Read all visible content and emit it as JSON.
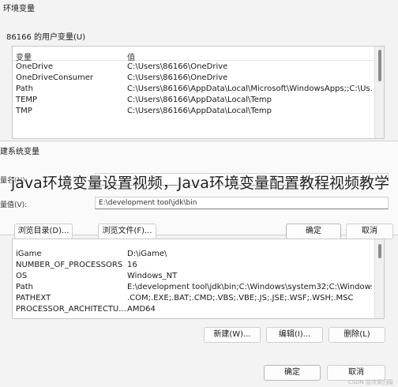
{
  "window": {
    "title": "环境变量"
  },
  "user_vars": {
    "group_title": "86166 的用户变量(U)",
    "headers": {
      "name": "变量",
      "value": "值"
    },
    "rows": [
      {
        "name": "OneDrive",
        "value": "C:\\Users\\86166\\OneDrive"
      },
      {
        "name": "OneDriveConsumer",
        "value": "C:\\Users\\86166\\OneDrive"
      },
      {
        "name": "Path",
        "value": "C:\\Users\\86166\\AppData\\Local\\Microsoft\\WindowsApps;;C:\\Us..."
      },
      {
        "name": "TEMP",
        "value": "C:\\Users\\86166\\AppData\\Local\\Temp"
      },
      {
        "name": "TMP",
        "value": "C:\\Users\\86166\\AppData\\Local\\Temp"
      }
    ]
  },
  "dialog": {
    "title": "建系统变量",
    "name_label": "量名(N):",
    "value_label": "量值(V):",
    "value_input": "E:\\development tool\\jdk\\bin",
    "browse_dir_label": "浏览目录(D)...",
    "browse_file_label": "浏览文件(F)...",
    "ok_label": "确定",
    "cancel_label": "取消"
  },
  "overlay_text": "java环境变量设置视频，Java环境变量配置教程视频教学",
  "sys_vars": {
    "rows": [
      {
        "name": "iGame",
        "value": "D:\\iGame\\"
      },
      {
        "name": "NUMBER_OF_PROCESSORS",
        "value": "16"
      },
      {
        "name": "OS",
        "value": "Windows_NT"
      },
      {
        "name": "Path",
        "value": "E:\\development tool\\jdk\\bin;C:\\Windows\\system32;C:\\Windows..."
      },
      {
        "name": "PATHEXT",
        "value": ".COM;.EXE;.BAT;.CMD;.VBS;.VBE;.JS;.JSE;.WSF;.WSH;.MSC"
      },
      {
        "name": "PROCESSOR_ARCHITECTU...",
        "value": "AMD64"
      }
    ],
    "new_label": "新建(W)...",
    "edit_label": "编辑(I)...",
    "delete_label": "删除(L)"
  },
  "footer": {
    "ok_label": "确定",
    "cancel_label": "取消"
  },
  "watermark": "CSDN @冷风归隐"
}
